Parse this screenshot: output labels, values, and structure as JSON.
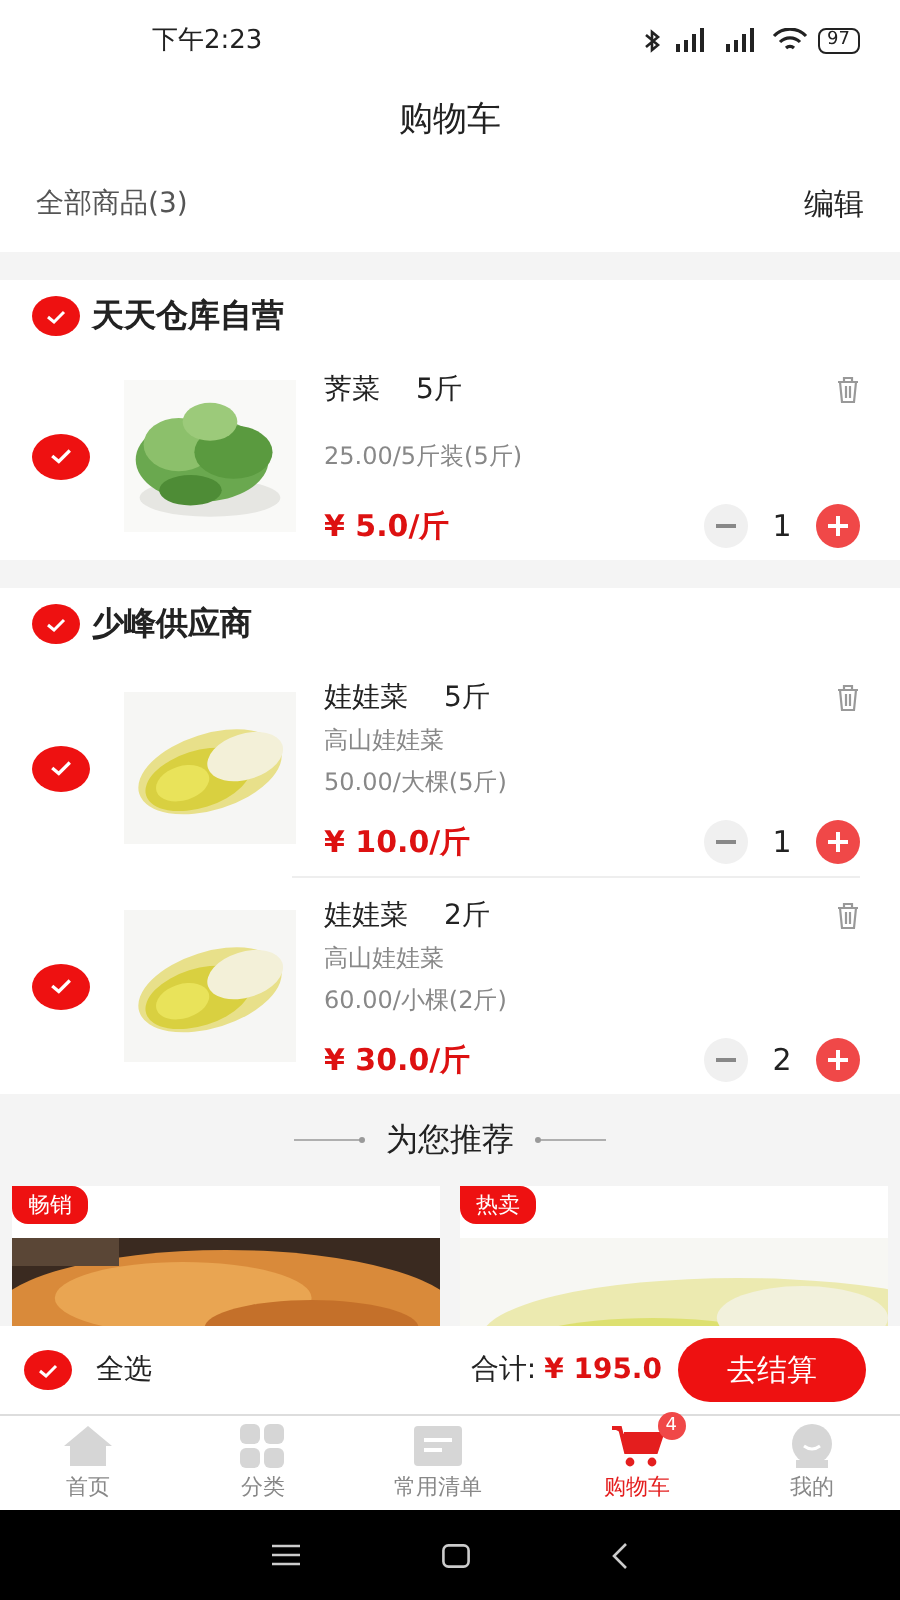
{
  "status_bar": {
    "time": "下午2:23",
    "battery": "97"
  },
  "title": "购物车",
  "header": {
    "count_label": "全部商品(3)",
    "edit": "编辑"
  },
  "stores": [
    {
      "name": "天天仓库自营",
      "checked": true,
      "items": [
        {
          "name": "荠菜",
          "weight": "5斤",
          "spec": "25.00/5斤装(5斤)",
          "price": "¥ 5.0/斤",
          "quantity": "1",
          "checked": true
        }
      ]
    },
    {
      "name": "少峰供应商",
      "checked": true,
      "items": [
        {
          "name": "娃娃菜",
          "weight": "5斤",
          "subtitle": "高山娃娃菜",
          "spec": "50.00/大棵(5斤)",
          "price": "¥ 10.0/斤",
          "quantity": "1",
          "checked": true
        },
        {
          "name": "娃娃菜",
          "weight": "2斤",
          "subtitle": "高山娃娃菜",
          "spec": "60.00/小棵(2斤)",
          "price": "¥ 30.0/斤",
          "quantity": "2",
          "checked": true
        }
      ]
    }
  ],
  "recommend": {
    "title": "为您推荐",
    "items": [
      {
        "tag": "畅销"
      },
      {
        "tag": "热卖"
      }
    ]
  },
  "checkout": {
    "select_all": "全选",
    "checked": true,
    "total_label": "合计:",
    "total": "¥ 195.0",
    "button": "去结算"
  },
  "tabs": [
    {
      "label": "首页",
      "kind": "home",
      "selected": false
    },
    {
      "label": "分类",
      "kind": "category",
      "selected": false
    },
    {
      "label": "常用清单",
      "kind": "list",
      "selected": false
    },
    {
      "label": "购物车",
      "kind": "cart",
      "selected": true,
      "badge": "4"
    },
    {
      "label": "我的",
      "kind": "profile",
      "selected": false
    }
  ]
}
